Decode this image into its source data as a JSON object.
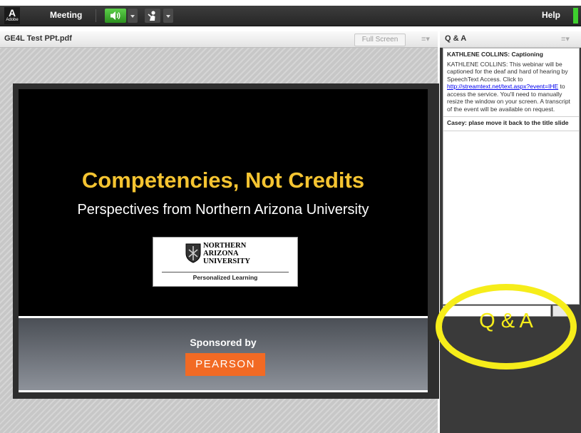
{
  "topbar": {
    "logo_letter": "A",
    "logo_word": "Adobe",
    "meeting_menu": "Meeting",
    "help_menu": "Help",
    "icons": [
      "speaker-icon",
      "chevron-down-icon",
      "presenter-icon",
      "chevron-down-icon"
    ],
    "audio_color": "#3fb52c",
    "status_color": "#3ecf2e"
  },
  "share_pod": {
    "title": "GE4L Test PPt.pdf",
    "fullscreen_label": "Full Screen",
    "menu_icon": "≡▾"
  },
  "slide": {
    "title": "Competencies, Not Credits",
    "subtitle": "Perspectives from Northern Arizona University",
    "logo_line1": "NORTHERN",
    "logo_line2": "ARIZONA",
    "logo_line3": "UNIVERSITY",
    "logo_tagline": "Personalized Learning",
    "sponsored_by": "Sponsored by",
    "sponsor": "PEARSON",
    "title_color": "#f5c431",
    "sponsor_color": "#f26a24"
  },
  "qa_pod": {
    "title": "Q & A",
    "menu_icon": "≡▾",
    "items": [
      {
        "question": "KATHLENE COLLINS: Captioning",
        "answer_before_link": "KATHLENE COLLINS: This webinar will be captioned for the deaf and hard of hearing by SpeechText Access. Click to",
        "link": "http://streamtext.net/text.aspx?event=IHE",
        "answer_after_link": "to access the service. You'll need to manually resize the window on your screen. A transcript of the event will be available on request."
      },
      {
        "question": "Casey: plase move it back to the title slide"
      }
    ]
  },
  "annotation": {
    "text": "Q & A",
    "color": "#f6ed1a"
  }
}
